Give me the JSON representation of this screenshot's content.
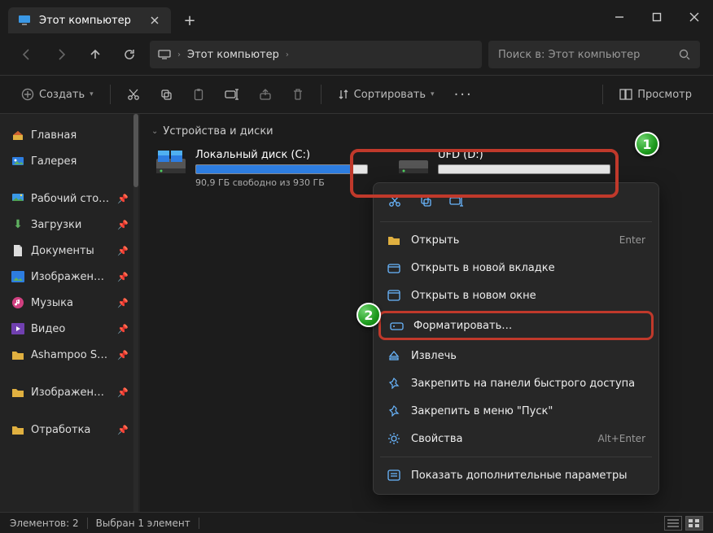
{
  "tab": {
    "title": "Этот компьютер"
  },
  "breadcrumb": {
    "label": "Этот компьютер"
  },
  "search": {
    "placeholder": "Поиск в: Этот компьютер"
  },
  "toolbar": {
    "create": "Создать",
    "sort": "Сортировать",
    "view": "Просмотр"
  },
  "sidebar": {
    "home": "Главная",
    "gallery": "Галерея",
    "items": [
      {
        "label": "Рабочий сто…"
      },
      {
        "label": "Загрузки"
      },
      {
        "label": "Документы"
      },
      {
        "label": "Изображени…"
      },
      {
        "label": "Музыка"
      },
      {
        "label": "Видео"
      },
      {
        "label": "Ashampoo Snap…"
      },
      {
        "label": "Изображени…"
      },
      {
        "label": "Отработка"
      }
    ]
  },
  "group": {
    "header": "Устройства и диски"
  },
  "drives": [
    {
      "name": "Локальный диск (C:)",
      "sub": "90,9 ГБ свободно из 930 ГБ",
      "fillPct": 90
    },
    {
      "name": "UFD (D:)",
      "sub": "",
      "fillPct": 0
    }
  ],
  "ctx": {
    "open": "Открыть",
    "open_tab": "Открыть в новой вкладке",
    "open_win": "Открыть в новом окне",
    "format": "Форматировать…",
    "eject": "Извлечь",
    "pin_quick": "Закрепить на панели быстрого доступа",
    "pin_start": "Закрепить в меню \"Пуск\"",
    "props": "Свойства",
    "more": "Показать дополнительные параметры",
    "k_open": "Enter",
    "k_props": "Alt+Enter"
  },
  "status": {
    "count": "Элементов: 2",
    "sel": "Выбран 1 элемент"
  },
  "badges": {
    "n1": "1",
    "n2": "2"
  }
}
